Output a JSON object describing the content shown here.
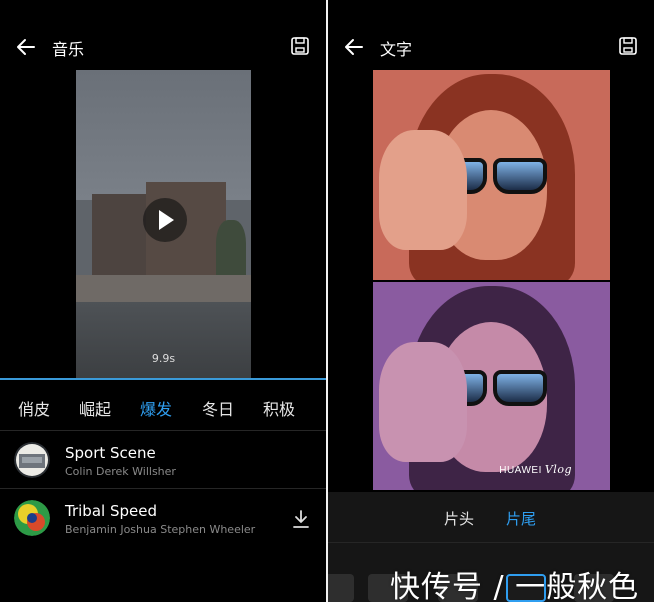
{
  "left": {
    "header": {
      "title": "音乐"
    },
    "preview": {
      "duration": "9.9s"
    },
    "categories": [
      "俏皮",
      "崛起",
      "爆发",
      "冬日",
      "积极"
    ],
    "active_category": "爆发",
    "tracks": [
      {
        "title": "Sport Scene",
        "artist": "Colin Derek Willsher",
        "downloaded": true
      },
      {
        "title": "Tribal Speed",
        "artist": "Benjamin Joshua Stephen Wheeler",
        "downloaded": false
      }
    ]
  },
  "right": {
    "header": {
      "title": "文字"
    },
    "watermark": {
      "brand": "HUAWEI",
      "script": "Vlog"
    },
    "tabs": [
      "片头",
      "片尾"
    ],
    "active_tab": "片尾"
  },
  "overlay": {
    "source_mark": "快传号 / 一般秋色"
  },
  "colors": {
    "accent": "#2f9ef0",
    "background": "#000000",
    "secondary_text": "#8a8a8a"
  }
}
